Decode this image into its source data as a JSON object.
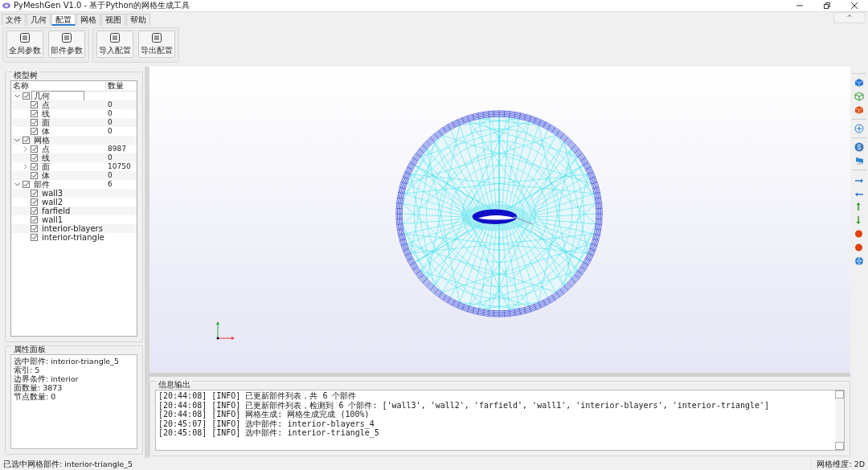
{
  "window": {
    "title": "PyMeshGen V1.0 - 基于Python的网格生成工具"
  },
  "tabs": [
    {
      "label": "文件",
      "selected": false
    },
    {
      "label": "几何",
      "selected": false
    },
    {
      "label": "配置",
      "selected": true
    },
    {
      "label": "网格",
      "selected": false
    },
    {
      "label": "视图",
      "selected": false
    },
    {
      "label": "帮助",
      "selected": false
    }
  ],
  "ribbon_toggle": "^",
  "ribbon_groups": [
    {
      "buttons": [
        "全局参数",
        "部件参数"
      ]
    },
    {
      "buttons": [
        "导入配置",
        "导出配置"
      ]
    }
  ],
  "model_tree": {
    "title": "模型树",
    "columns": [
      "名称",
      "数量"
    ],
    "nodes": [
      {
        "name": "几何",
        "checked": true,
        "expanded": true,
        "focused": true,
        "children": [
          {
            "name": "点",
            "count": "0",
            "checked": true
          },
          {
            "name": "线",
            "count": "0",
            "checked": true
          },
          {
            "name": "面",
            "count": "0",
            "checked": true
          },
          {
            "name": "体",
            "count": "0",
            "checked": true
          }
        ]
      },
      {
        "name": "网格",
        "checked": true,
        "expanded": true,
        "focused": false,
        "children": [
          {
            "name": "点",
            "count": "8987",
            "checked": true,
            "expanded": false
          },
          {
            "name": "线",
            "count": "0",
            "checked": true
          },
          {
            "name": "面",
            "count": "10750",
            "checked": true,
            "expanded": false
          },
          {
            "name": "体",
            "count": "0",
            "checked": true
          }
        ]
      },
      {
        "name": "部件",
        "count": "6",
        "checked": true,
        "expanded": true,
        "focused": false,
        "children": [
          {
            "name": "wall3",
            "checked": true
          },
          {
            "name": "wall2",
            "checked": true
          },
          {
            "name": "farfield",
            "checked": true
          },
          {
            "name": "wall1",
            "checked": true
          },
          {
            "name": "interior-blayers",
            "checked": true
          },
          {
            "name": "interior-triangle",
            "checked": true
          }
        ]
      }
    ]
  },
  "property_panel": {
    "title": "属性面板",
    "lines": [
      "选中部件: interior-triangle_5",
      "索引: 5",
      "边界条件: interior",
      "面数量: 3873",
      "节点数量: 0"
    ]
  },
  "info_output": {
    "title": "信息输出",
    "lines": [
      "[20:44:08] [INFO] 已更新部件列表，共 6 个部件",
      "[20:44:08] [INFO] 已更新部件列表，检测到 6 个部件: ['wall3', 'wall2', 'farfield', 'wall1', 'interior-blayers', 'interior-triangle']",
      "[20:44:08] [INFO] 网格生成: 网格生成完成 (100%)",
      "[20:45:07] [INFO] 选中部件: interior-blayers_4",
      "[20:45:08] [INFO] 选中部件: interior-triangle_5"
    ]
  },
  "status_bar": {
    "left": "已选中网格部件: interior-triangle_5",
    "right": "网格维度: 2D"
  }
}
